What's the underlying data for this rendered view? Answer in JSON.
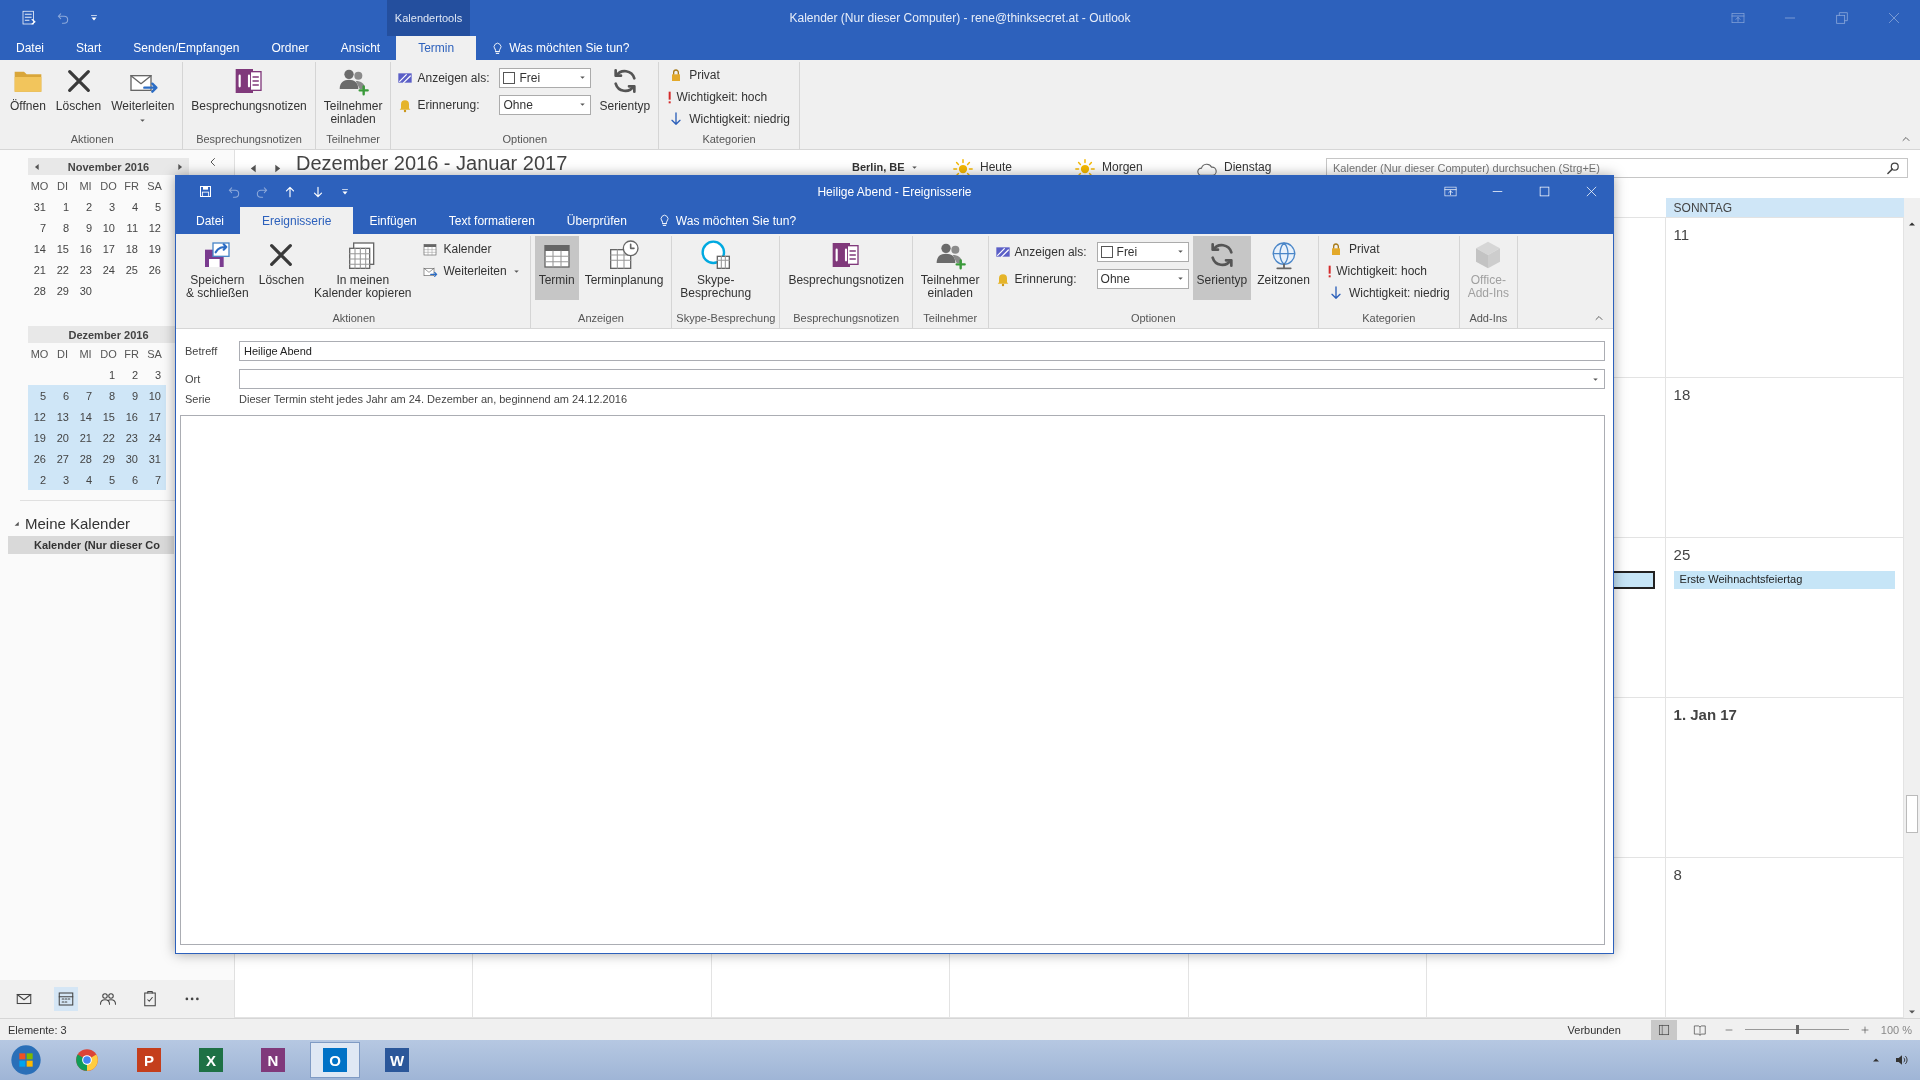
{
  "outlook": {
    "title": "Kalender (Nur dieser Computer) - rene@thinksecret.at - Outlook",
    "context_group": "Kalendertools",
    "tabs": [
      {
        "label": "Datei",
        "selected": false
      },
      {
        "label": "Start",
        "selected": false
      },
      {
        "label": "Senden/Empfangen",
        "selected": false
      },
      {
        "label": "Ordner",
        "selected": false
      },
      {
        "label": "Ansicht",
        "selected": false
      },
      {
        "label": "Termin",
        "selected": true
      }
    ],
    "tell_me": "Was möchten Sie tun?",
    "ribbon": [
      {
        "label": "Aktionen",
        "items": [
          {
            "kind": "large",
            "label": "Öffnen",
            "selected": false,
            "disabled": false
          },
          {
            "kind": "large",
            "label": "Löschen",
            "selected": false,
            "disabled": false
          },
          {
            "kind": "large",
            "label": "Weiterleiten",
            "selected": false,
            "disabled": false,
            "menu": true
          }
        ]
      },
      {
        "label": "Besprechungsnotizen",
        "items": [
          {
            "kind": "large",
            "label": "Besprechungsnotizen",
            "selected": false,
            "disabled": false
          }
        ]
      },
      {
        "label": "Teilnehmer",
        "items": [
          {
            "kind": "large",
            "label": "Teilnehmer\neinladen",
            "selected": false,
            "disabled": false
          }
        ]
      },
      {
        "label": "Optionen",
        "items": [
          {
            "kind": "dropdown",
            "label": "Anzeigen als:",
            "value": "Frei",
            "swatch": true
          },
          {
            "kind": "dropdown",
            "label": "Erinnerung:",
            "value": "Ohne"
          },
          {
            "kind": "large",
            "label": "Serientyp",
            "selected": false,
            "disabled": false
          }
        ]
      },
      {
        "label": "Kategorien",
        "items": [
          {
            "kind": "small",
            "label": "Privat"
          },
          {
            "kind": "small",
            "label": "Wichtigkeit: hoch"
          },
          {
            "kind": "small",
            "label": "Wichtigkeit: niedrig"
          }
        ]
      }
    ]
  },
  "mini_calendars": [
    {
      "title": "November 2016",
      "arrows": true,
      "weekdays": [
        "MO",
        "DI",
        "MI",
        "DO",
        "FR",
        "SA"
      ],
      "weeks": [
        {
          "days": [
            "31",
            "1",
            "2",
            "3",
            "4",
            "5"
          ],
          "selected": false
        },
        {
          "days": [
            "7",
            "8",
            "9",
            "10",
            "11",
            "12"
          ],
          "selected": false
        },
        {
          "days": [
            "14",
            "15",
            "16",
            "17",
            "18",
            "19"
          ],
          "selected": false
        },
        {
          "days": [
            "21",
            "22",
            "23",
            "24",
            "25",
            "26"
          ],
          "selected": false
        },
        {
          "days": [
            "28",
            "29",
            "30"
          ],
          "selected": false
        }
      ]
    },
    {
      "title": "Dezember 2016",
      "weekdays": [
        "MO",
        "DI",
        "MI",
        "DO",
        "FR",
        "SA"
      ],
      "weeks": [
        {
          "days": [
            "1",
            "2",
            "3"
          ],
          "right_aligned": true,
          "selected": false
        },
        {
          "days": [
            "5",
            "6",
            "7",
            "8",
            "9",
            "10"
          ],
          "selected": true
        },
        {
          "days": [
            "12",
            "13",
            "14",
            "15",
            "16",
            "17"
          ],
          "selected": true
        },
        {
          "days": [
            "19",
            "20",
            "21",
            "22",
            "23",
            "24"
          ],
          "selected": true
        },
        {
          "days": [
            "26",
            "27",
            "28",
            "29",
            "30",
            "31"
          ],
          "selected": true
        },
        {
          "days": [
            "2",
            "3",
            "4",
            "5",
            "6",
            "7"
          ],
          "selected": true
        }
      ]
    }
  ],
  "folders": {
    "title": "Meine Kalender",
    "expanded": true,
    "items": [
      {
        "label": "Kalender (Nur dieser Co",
        "selected": true
      }
    ]
  },
  "navigation": [
    {
      "selected": false
    },
    {
      "selected": true
    },
    {
      "selected": false
    },
    {
      "selected": false
    },
    {
      "selected": false
    }
  ],
  "calendar": {
    "title": "Dezember 2016 - Januar 2017",
    "location": "Berlin, BE",
    "forecast": [
      {
        "label": "Heute",
        "kind": "sunny"
      },
      {
        "label": "Morgen",
        "kind": "sunny"
      },
      {
        "label": "Dienstag",
        "kind": "cloudy"
      }
    ],
    "search": {
      "placeholder": "Kalender (Nur dieser Computer) durchsuchen (Strg+E)"
    },
    "day_header": "SONNTAG",
    "weeks": [
      {
        "sunday": "11",
        "month_start": false
      },
      {
        "sunday": "18",
        "month_start": false
      },
      {
        "sunday": "25",
        "month_start": false,
        "saturday_events": [
          {
            "selected": true
          }
        ],
        "sunday_events": [
          {
            "title": "Erste Weihnachtsfeiertag"
          }
        ]
      },
      {
        "sunday": "1. Jan 17",
        "month_start": true
      },
      {
        "sunday": "8",
        "month_start": false
      }
    ]
  },
  "dialog": {
    "title": "Heilige Abend - Ereignisserie",
    "tabs": [
      {
        "label": "Datei",
        "selected": false
      },
      {
        "label": "Ereignisserie",
        "selected": true
      },
      {
        "label": "Einfügen",
        "selected": false
      },
      {
        "label": "Text formatieren",
        "selected": false
      },
      {
        "label": "Überprüfen",
        "selected": false
      }
    ],
    "tell_me": "Was möchten Sie tun?",
    "ribbon": [
      {
        "label": "Aktionen",
        "items": [
          {
            "kind": "large",
            "label": "Speichern\n& schließen",
            "selected": false,
            "disabled": false
          },
          {
            "kind": "large",
            "label": "Löschen",
            "selected": false,
            "disabled": false
          },
          {
            "kind": "large",
            "label": "In meinen\nKalender kopieren",
            "selected": false,
            "disabled": false
          },
          {
            "kind": "small",
            "label": "Kalender"
          },
          {
            "kind": "small",
            "label": "Weiterleiten",
            "menu": true
          }
        ]
      },
      {
        "label": "Anzeigen",
        "items": [
          {
            "kind": "large",
            "label": "Termin",
            "selected": true,
            "disabled": false
          },
          {
            "kind": "large",
            "label": "Terminplanung",
            "selected": false,
            "disabled": false
          }
        ]
      },
      {
        "label": "Skype-Besprechung",
        "items": [
          {
            "kind": "large",
            "label": "Skype-\nBesprechung",
            "selected": false,
            "disabled": false
          }
        ]
      },
      {
        "label": "Besprechungsnotizen",
        "items": [
          {
            "kind": "large",
            "label": "Besprechungsnotizen",
            "selected": false,
            "disabled": false
          }
        ]
      },
      {
        "label": "Teilnehmer",
        "items": [
          {
            "kind": "large",
            "label": "Teilnehmer\neinladen",
            "selected": false,
            "disabled": false
          }
        ]
      },
      {
        "label": "Optionen",
        "items": [
          {
            "kind": "dropdown",
            "label": "Anzeigen als:",
            "value": "Frei",
            "swatch": true
          },
          {
            "kind": "dropdown",
            "label": "Erinnerung:",
            "value": "Ohne"
          },
          {
            "kind": "large",
            "label": "Serientyp",
            "selected": true,
            "disabled": false
          },
          {
            "kind": "large",
            "label": "Zeitzonen",
            "selected": false,
            "disabled": false
          }
        ]
      },
      {
        "label": "Kategorien",
        "items": [
          {
            "kind": "small",
            "label": "Privat"
          },
          {
            "kind": "small",
            "label": "Wichtigkeit: hoch"
          },
          {
            "kind": "small",
            "label": "Wichtigkeit: niedrig"
          }
        ]
      },
      {
        "label": "Add-Ins",
        "items": [
          {
            "kind": "large",
            "label": "Office-\nAdd-Ins",
            "selected": false,
            "disabled": true
          }
        ]
      }
    ],
    "fields": [
      {
        "label": "Betreff",
        "value": "Heilige Abend"
      },
      {
        "label": "Ort",
        "dropdown": true
      }
    ],
    "series": {
      "label": "Serie",
      "text": "Dieser Termin steht jedes Jahr am 24. Dezember an, beginnend am 24.12.2016"
    }
  },
  "status": {
    "items": "Elemente: 3",
    "connection": "Verbunden",
    "views": [
      {
        "selected": true
      },
      {
        "selected": false
      }
    ],
    "zoom": {
      "level": 0.5,
      "reading": "100 %"
    }
  },
  "taskbar": {
    "apps": [
      {
        "kind": "browser",
        "selected": false
      },
      {
        "kind": "office",
        "letter": "P",
        "color": "#c43e1c",
        "selected": false
      },
      {
        "kind": "office",
        "letter": "X",
        "color": "#1e7145",
        "selected": false
      },
      {
        "kind": "office",
        "letter": "N",
        "color": "#80397b",
        "selected": false
      },
      {
        "kind": "office",
        "letter": "O",
        "color": "#0072c6",
        "selected": true
      },
      {
        "kind": "office",
        "letter": "W",
        "color": "#2b579a",
        "selected": false
      }
    ]
  }
}
